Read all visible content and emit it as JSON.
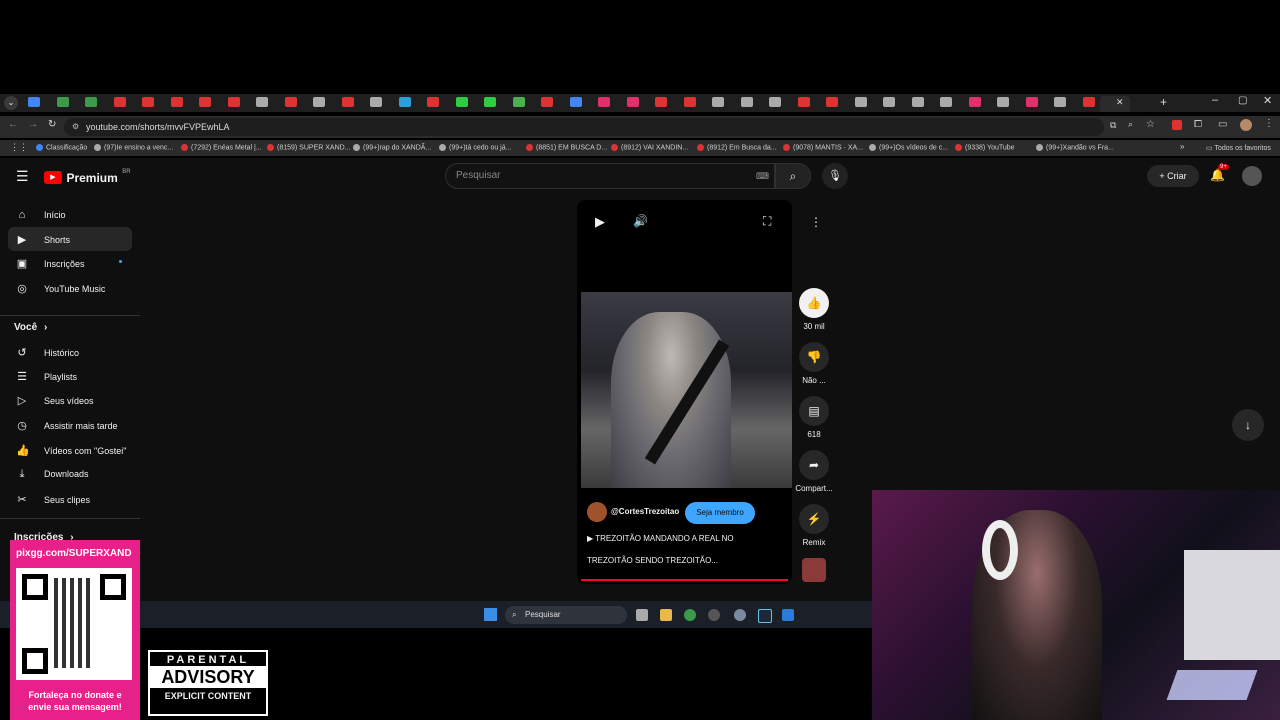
{
  "browser": {
    "url": "youtube.com/shorts/mvvFVPEwhLA",
    "bookmarks": [
      "Classificação",
      "(97)Ie ensino a venc...",
      "(7292) Enéas Metal |...",
      "(8159) SUPER XAND...",
      "(99+)rap do XANDÃ...",
      "(99+)tá cedo ou já...",
      "(8851) EM BUSCA D...",
      "(8912) VAI XANDIN...",
      "(8912) Em Busca da...",
      "(9078) MANTIS · XA...",
      "(99+)Os vídeos de c...",
      "(9338) YouTube",
      "(99+)Xandão vs Fra..."
    ],
    "all_bookmarks": "Todos os favoritos",
    "colors": {
      "tab_bar": "#1f1f1f",
      "toolbar": "#2b2b2b",
      "youtube_red": "#ff0000"
    }
  },
  "youtube": {
    "logo": "Premium",
    "country": "BR",
    "search_placeholder": "Pesquisar",
    "create": "Criar",
    "notif_count": "9+",
    "sidebar": {
      "main": [
        {
          "label": "Início",
          "icon": "home-icon"
        },
        {
          "label": "Shorts",
          "icon": "shorts-icon"
        },
        {
          "label": "Inscrições",
          "icon": "subscriptions-icon"
        },
        {
          "label": "YouTube Music",
          "icon": "music-icon"
        }
      ],
      "you_heading": "Você",
      "you": [
        {
          "label": "Histórico",
          "icon": "history-icon"
        },
        {
          "label": "Playlists",
          "icon": "playlists-icon"
        },
        {
          "label": "Seus vídeos",
          "icon": "your-videos-icon"
        },
        {
          "label": "Assistir mais tarde",
          "icon": "watch-later-icon"
        },
        {
          "label": "Vídeos com \"Gostei\"",
          "icon": "like-icon"
        },
        {
          "label": "Downloads",
          "icon": "download-icon"
        },
        {
          "label": "Seus clipes",
          "icon": "clips-icon"
        }
      ],
      "subs_heading": "Inscrições"
    },
    "short": {
      "channel": "@CortesTrezoitao",
      "join": "Seja membro",
      "title_line1": "TREZOITÃO MANDANDO A REAL NO",
      "title_line2": "TREZOITÃO SENDO TREZOITÃO...",
      "likes": "30 mil",
      "dislike": "Não ...",
      "comments": "618",
      "share": "Compart...",
      "remix": "Remix"
    }
  },
  "taskbar": {
    "search": "Pesquisar"
  },
  "overlay": {
    "qr_url": "pixgg.com/SUPERXAND",
    "qr_caption_1": "Fortaleça no donate e",
    "qr_caption_2": "envie sua mensagem!",
    "advisory_1": "PARENTAL",
    "advisory_2": "ADVISORY",
    "advisory_3": "EXPLICIT CONTENT"
  }
}
